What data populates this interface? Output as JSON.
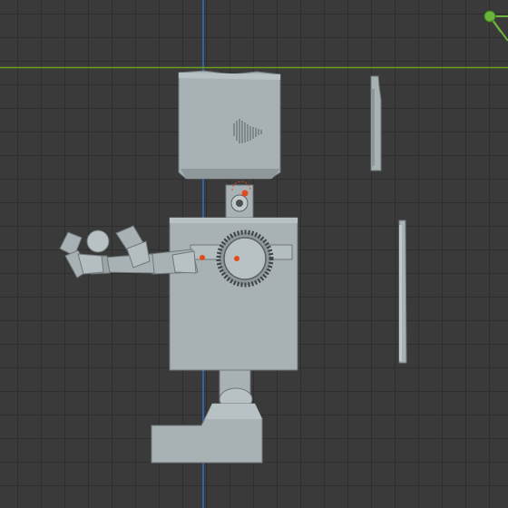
{
  "viewport": {
    "kind": "3d-viewport-orthographic-front",
    "background_color": "#3a3a3a",
    "grid_color": "#2f2f2f",
    "x_axis_color": "#6b9e1f",
    "z_axis_color": "#2f6fc9"
  },
  "gizmo": {
    "icon": "axis-gizmo-icon",
    "y_axis_color": "#6ab43a"
  },
  "scene": {
    "object_color": "#a8b2b4",
    "object_shade_color": "#8e9799",
    "object_edge_color": "#6f7779",
    "origin_marker_color": "#e24a1c",
    "objects": [
      "head",
      "neck-joint",
      "torso",
      "shoulder-joint",
      "upper-arm",
      "forearm",
      "hand",
      "leg",
      "foot",
      "side-panel-top",
      "side-panel-bottom"
    ]
  }
}
